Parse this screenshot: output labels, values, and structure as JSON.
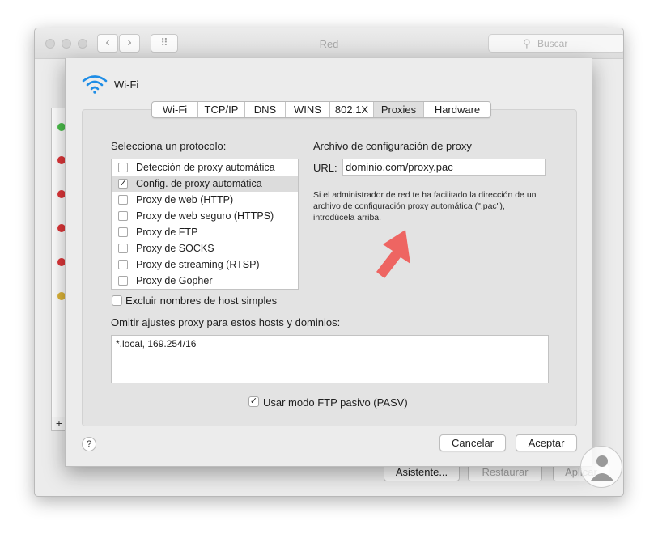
{
  "background_window": {
    "title": "Red",
    "search_placeholder": "Buscar",
    "nav_back": "‹",
    "nav_forward": "›",
    "grid_glyph": "⠿",
    "add_glyph": "+",
    "buttons": {
      "assistant": "Asistente...",
      "restore": "Restaurar",
      "apply": "Aplicar"
    },
    "status_dot_colors": [
      "#4cc04c",
      "#e0373a",
      "#e0373a",
      "#e0373a",
      "#e0373a",
      "#e0b73a"
    ]
  },
  "sheet": {
    "title": "Wi-Fi",
    "wifi_icon": "wifi-icon",
    "tabs": [
      {
        "label": "Wi-Fi",
        "active": false
      },
      {
        "label": "TCP/IP",
        "active": false
      },
      {
        "label": "DNS",
        "active": false
      },
      {
        "label": "WINS",
        "active": false
      },
      {
        "label": "802.1X",
        "active": false
      },
      {
        "label": "Proxies",
        "active": true
      },
      {
        "label": "Hardware",
        "active": false
      }
    ],
    "protocol_heading": "Selecciona un protocolo:",
    "protocols": [
      {
        "label": "Detección de proxy automática",
        "checked": false,
        "selected": false
      },
      {
        "label": "Config. de proxy automática",
        "checked": true,
        "selected": true
      },
      {
        "label": "Proxy de web (HTTP)",
        "checked": false,
        "selected": false
      },
      {
        "label": "Proxy de web seguro (HTTPS)",
        "checked": false,
        "selected": false
      },
      {
        "label": "Proxy de FTP",
        "checked": false,
        "selected": false
      },
      {
        "label": "Proxy de SOCKS",
        "checked": false,
        "selected": false
      },
      {
        "label": "Proxy de streaming (RTSP)",
        "checked": false,
        "selected": false
      },
      {
        "label": "Proxy de Gopher",
        "checked": false,
        "selected": false
      }
    ],
    "config_heading": "Archivo de configuración de proxy",
    "url_label": "URL:",
    "url_value": "dominio.com/proxy.pac",
    "help_text": "Si el administrador de red te ha facilitado la dirección de un archivo de configuración proxy automática (\".pac\"), introdúcela arriba.",
    "exclude_simple": {
      "label": "Excluir nombres de host simples",
      "checked": false
    },
    "bypass_heading": "Omitir ajustes proxy para estos hosts y dominios:",
    "bypass_value": "*.local, 169.254/16",
    "passive_ftp": {
      "label": "Usar modo FTP pasivo (PASV)",
      "checked": true
    },
    "help_glyph": "?",
    "cancel_label": "Cancelar",
    "accept_label": "Aceptar",
    "check_glyph": "✓",
    "accent_arrow_color": "#ef5350"
  }
}
